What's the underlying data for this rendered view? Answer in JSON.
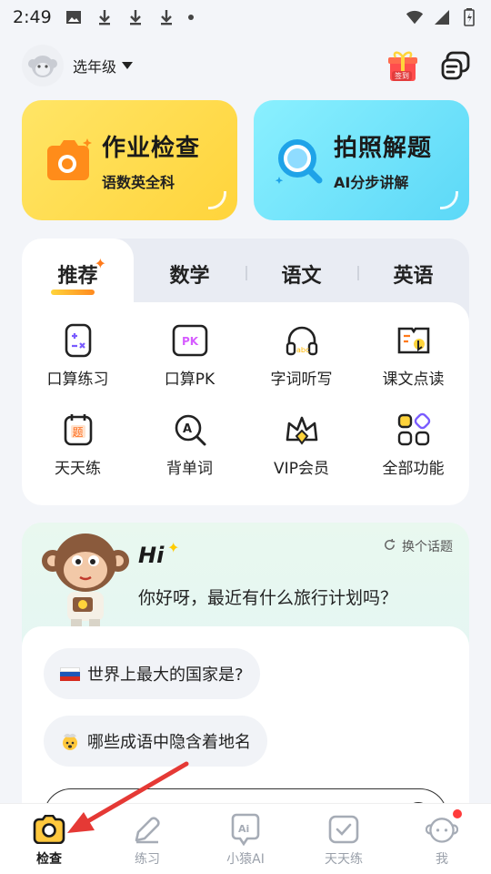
{
  "status_bar": {
    "time": "2:49"
  },
  "header": {
    "grade_select": "选年级",
    "signin_badge": "签到"
  },
  "cards": [
    {
      "title": "作业检查",
      "subtitle": "语数英全科"
    },
    {
      "title": "拍照解题",
      "subtitle": "AI分步讲解"
    }
  ],
  "tabs": [
    {
      "label": "推荐"
    },
    {
      "label": "数学"
    },
    {
      "label": "语文"
    },
    {
      "label": "英语"
    }
  ],
  "features": [
    {
      "label": "口算练习",
      "icon": "calc-practice-icon"
    },
    {
      "label": "口算PK",
      "icon": "pk-icon"
    },
    {
      "label": "字词听写",
      "icon": "headphones-icon"
    },
    {
      "label": "课文点读",
      "icon": "book-read-icon"
    },
    {
      "label": "天天练",
      "icon": "daily-question-icon"
    },
    {
      "label": "背单词",
      "icon": "word-search-icon"
    },
    {
      "label": "VIP会员",
      "icon": "vip-crown-icon"
    },
    {
      "label": "全部功能",
      "icon": "all-apps-icon"
    }
  ],
  "chat": {
    "hi": "Hi",
    "change_topic": "换个话题",
    "greeting": "你好呀，最近有什么旅行计划吗？",
    "suggestions": [
      {
        "emoji": "🇷🇺",
        "text": "世界上最大的国家是?"
      },
      {
        "emoji": "🤯",
        "text": "哪些成语中隐含着地名"
      }
    ]
  },
  "bottom_nav": [
    {
      "label": "检查",
      "active": true
    },
    {
      "label": "练习",
      "active": false
    },
    {
      "label": "小猿AI",
      "active": false
    },
    {
      "label": "天天练",
      "active": false
    },
    {
      "label": "我",
      "active": false
    }
  ],
  "colors": {
    "accent_yellow": "#ffd43b",
    "accent_blue": "#5cd8f7",
    "annotation_red": "#e53935"
  }
}
